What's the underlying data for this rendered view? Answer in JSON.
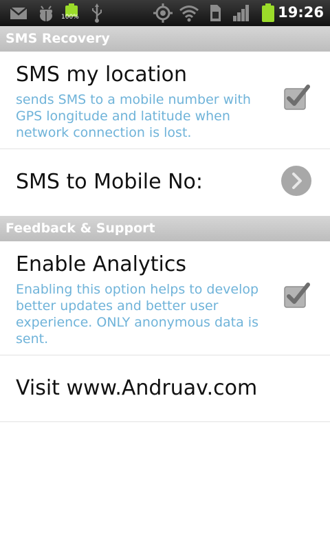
{
  "statusbar": {
    "time": "19:26",
    "battery_percent_label": "100%",
    "icons": [
      "gmail-icon",
      "android-debug-icon",
      "battery-charging-icon",
      "usb-icon",
      "gps-icon",
      "wifi-icon",
      "sim-icon",
      "signal-icon",
      "battery-icon"
    ]
  },
  "sections": [
    {
      "header": "SMS Recovery",
      "items": [
        {
          "title": "SMS my location",
          "summary": "sends SMS to a mobile number with GPS longitude and latitude when network connection is lost.",
          "widget": "checkbox",
          "checked": true
        },
        {
          "title": "SMS to Mobile No:",
          "widget": "chevron-right-icon"
        }
      ]
    },
    {
      "header": "Feedback & Support",
      "items": [
        {
          "title": "Enable Analytics",
          "summary": "Enabling this option helps to develop better updates and better user experience. ONLY anonymous data is sent.",
          "widget": "checkbox",
          "checked": true
        },
        {
          "title": "Visit www.Andruav.com"
        }
      ]
    }
  ],
  "colors": {
    "header_bg": "#c9c9c9",
    "summary_text": "#6fb3d9",
    "title_text": "#111111",
    "statusbar_bg": "#1e1e1e"
  }
}
